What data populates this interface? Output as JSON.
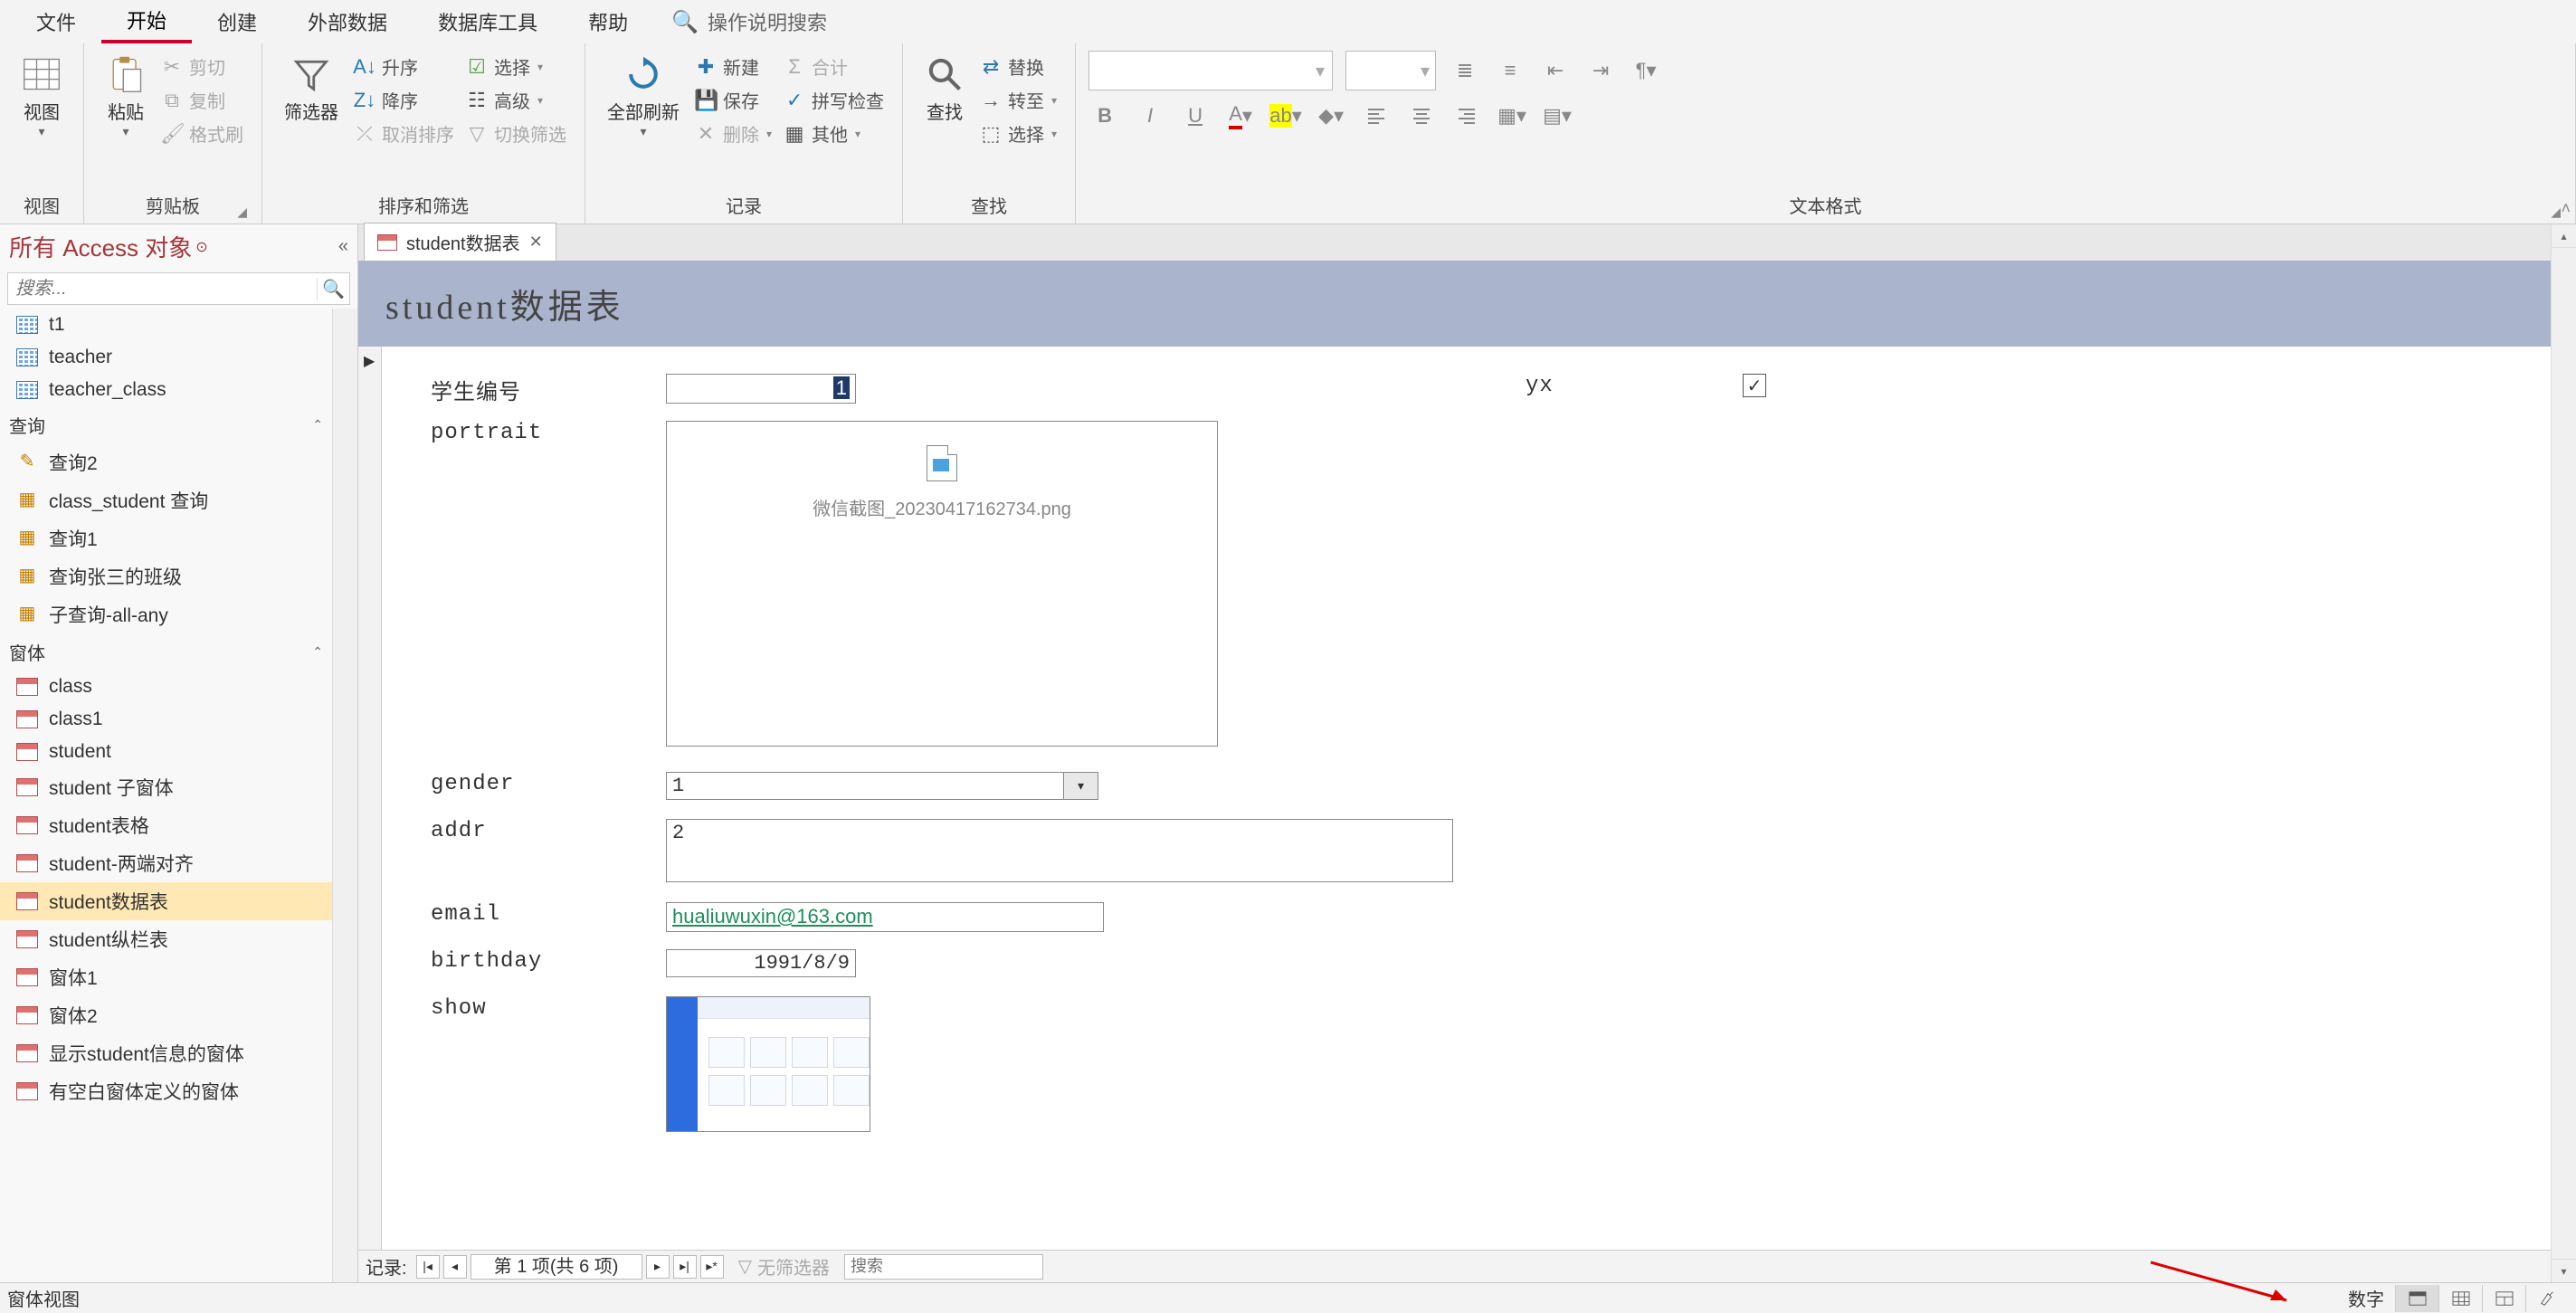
{
  "menu": {
    "tabs": [
      "文件",
      "开始",
      "创建",
      "外部数据",
      "数据库工具",
      "帮助"
    ],
    "active_index": 1,
    "tell_me": "操作说明搜索"
  },
  "ribbon": {
    "groups": {
      "view": {
        "label": "视图",
        "button": "视图"
      },
      "clipboard": {
        "label": "剪贴板",
        "paste": "粘贴",
        "cut": "剪切",
        "copy": "复制",
        "painter": "格式刷"
      },
      "sortfilter": {
        "label": "排序和筛选",
        "filter": "筛选器",
        "asc": "升序",
        "desc": "降序",
        "clear": "取消排序",
        "selection": "选择",
        "advanced": "高级",
        "toggle": "切换筛选"
      },
      "records": {
        "label": "记录",
        "refresh": "全部刷新",
        "new": "新建",
        "save": "保存",
        "delete": "删除",
        "totals": "合计",
        "spell": "拼写检查",
        "more": "其他"
      },
      "find": {
        "label": "查找",
        "find": "查找",
        "replace": "替换",
        "goto": "转至",
        "select": "选择"
      },
      "textfmt": {
        "label": "文本格式"
      }
    }
  },
  "nav": {
    "title": "所有 Access 对象",
    "search_placeholder": "搜索...",
    "groups": [
      {
        "name": "表_hidden_header",
        "hidden": true,
        "items": [
          {
            "type": "table",
            "label": "t1"
          },
          {
            "type": "table",
            "label": "teacher"
          },
          {
            "type": "table",
            "label": "teacher_class"
          }
        ]
      },
      {
        "name": "查询",
        "items": [
          {
            "type": "query",
            "label": "查询2",
            "icon": "pencil"
          },
          {
            "type": "query",
            "label": "class_student 查询",
            "icon": "query"
          },
          {
            "type": "query",
            "label": "查询1",
            "icon": "query"
          },
          {
            "type": "query",
            "label": "查询张三的班级",
            "icon": "query"
          },
          {
            "type": "query",
            "label": "子查询-all-any",
            "icon": "query"
          }
        ]
      },
      {
        "name": "窗体",
        "items": [
          {
            "type": "form",
            "label": "class"
          },
          {
            "type": "form",
            "label": "class1"
          },
          {
            "type": "form",
            "label": "student"
          },
          {
            "type": "form",
            "label": "student 子窗体"
          },
          {
            "type": "form",
            "label": "student表格"
          },
          {
            "type": "form",
            "label": "student-两端对齐"
          },
          {
            "type": "form",
            "label": "student数据表",
            "selected": true
          },
          {
            "type": "form",
            "label": "student纵栏表"
          },
          {
            "type": "form",
            "label": "窗体1"
          },
          {
            "type": "form",
            "label": "窗体2"
          },
          {
            "type": "form",
            "label": "显示student信息的窗体"
          },
          {
            "type": "form",
            "label": "有空白窗体定义的窗体"
          }
        ]
      }
    ]
  },
  "doc": {
    "tab_title": "student数据表",
    "form_header": "student数据表",
    "fields": {
      "id": {
        "label": "学生编号",
        "value": "1"
      },
      "portrait": {
        "label": "portrait",
        "filename": "微信截图_20230417162734.png"
      },
      "yx": {
        "label": "yx",
        "checked": true
      },
      "gender": {
        "label": "gender",
        "value": "1"
      },
      "addr": {
        "label": "addr",
        "value": "2"
      },
      "email": {
        "label": "email",
        "value": "hualiuwuxin@163.com"
      },
      "birthday": {
        "label": "birthday",
        "value": "1991/8/9"
      },
      "show": {
        "label": "show"
      }
    }
  },
  "recnav": {
    "label": "记录:",
    "position": "第 1 项(共 6 项)",
    "filter": "无筛选器",
    "search_placeholder": "搜索"
  },
  "status": {
    "left": "窗体视图",
    "right": "数字"
  }
}
